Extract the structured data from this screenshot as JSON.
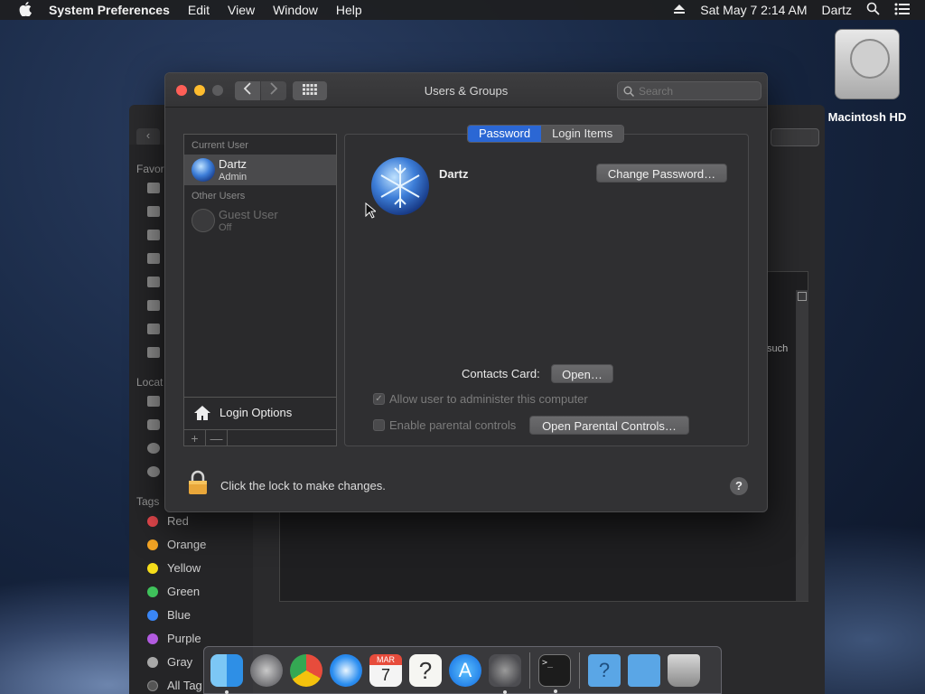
{
  "menubar": {
    "app_name": "System Preferences",
    "items": [
      "Edit",
      "View",
      "Window",
      "Help"
    ],
    "datetime": "Sat May 7  2:14 AM",
    "user": "Dartz"
  },
  "desktop": {
    "disk_label": "Macintosh HD"
  },
  "finder": {
    "sections": {
      "favorites": "Favor",
      "locations": "Locat",
      "tags": "Tags"
    },
    "tags": [
      {
        "label": "Red",
        "color": "#e5484d"
      },
      {
        "label": "Orange",
        "color": "#f5a524"
      },
      {
        "label": "Yellow",
        "color": "#f5dd1a"
      },
      {
        "label": "Green",
        "color": "#3fc25b"
      },
      {
        "label": "Blue",
        "color": "#3a86f5"
      },
      {
        "label": "Purple",
        "color": "#b25be0"
      },
      {
        "label": "Gray",
        "color": "#a8a8a8"
      },
      {
        "label": "All Tag",
        "color": "#555555"
      }
    ],
    "fragment_text": "such"
  },
  "window": {
    "title": "Users & Groups",
    "search_placeholder": "Search",
    "tabs": {
      "password": "Password",
      "login_items": "Login Items"
    },
    "users": {
      "current_header": "Current User",
      "current": {
        "name": "Dartz",
        "role": "Admin"
      },
      "other_header": "Other Users",
      "guest": {
        "name": "Guest User",
        "status": "Off"
      }
    },
    "login_options": "Login Options",
    "add_symbol": "+",
    "remove_symbol": "—",
    "detail": {
      "name": "Dartz",
      "change_password": "Change Password…",
      "contacts_label": "Contacts Card:",
      "open_button": "Open…",
      "allow_admin": "Allow user to administer this computer",
      "parental_controls": "Enable parental controls",
      "open_parental": "Open Parental Controls…"
    },
    "lock_message": "Click the lock to make changes.",
    "help": "?"
  },
  "dock": {
    "apps": [
      "finder-icon",
      "launchpad-icon",
      "chrome-icon",
      "safari-icon",
      "calendar-icon",
      "help-icon",
      "app-store-icon",
      "system-preferences-icon",
      "terminal-icon",
      "folder-help-icon",
      "downloads-folder-icon",
      "trash-icon"
    ],
    "calendar_month": "MAR",
    "calendar_day": "7",
    "terminal_prompt": ">_"
  },
  "colors": {
    "accent": "#2b67d4",
    "close": "#fe5f57",
    "minimize": "#febc2e",
    "zoom": "#5c5c5e"
  }
}
